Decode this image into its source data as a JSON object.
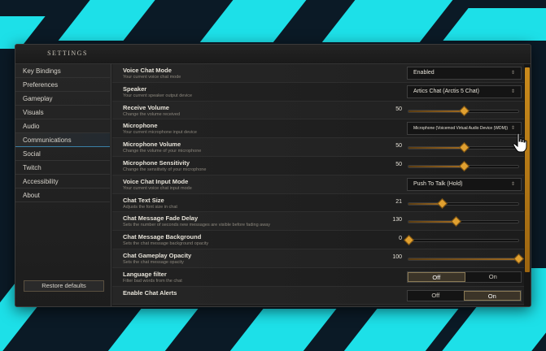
{
  "window": {
    "title": "SETTINGS"
  },
  "sidebar": {
    "items": [
      {
        "label": "Key Bindings"
      },
      {
        "label": "Preferences"
      },
      {
        "label": "Gameplay"
      },
      {
        "label": "Visuals"
      },
      {
        "label": "Audio"
      },
      {
        "label": "Communications",
        "active": true
      },
      {
        "label": "Social"
      },
      {
        "label": "Twitch"
      },
      {
        "label": "Accessibility"
      },
      {
        "label": "About"
      }
    ],
    "restore_label": "Restore defaults"
  },
  "settings": [
    {
      "title": "Voice Chat Mode",
      "desc": "Your current voice chat mode",
      "control": "dropdown",
      "value": "Enabled"
    },
    {
      "title": "Speaker",
      "desc": "Your current speaker output device",
      "control": "dropdown",
      "value": "Artics Chat (Arctis 5 Chat)"
    },
    {
      "title": "Receive Volume",
      "desc": "Change the volume received",
      "control": "slider",
      "value": "50",
      "level": 0.5
    },
    {
      "title": "Microphone",
      "desc": "Your current microphone input device",
      "control": "dropdown",
      "value": "Microphone (Voicemod Virtual Audio Device (WDM))",
      "small": true
    },
    {
      "title": "Microphone Volume",
      "desc": "Change the volume of your microphone",
      "control": "slider",
      "value": "50",
      "level": 0.5
    },
    {
      "title": "Microphone Sensitivity",
      "desc": "Change the sensitivity of your microphone",
      "control": "slider",
      "value": "50",
      "level": 0.5
    },
    {
      "title": "Voice Chat Input Mode",
      "desc": "Your current voice chat input mode",
      "control": "dropdown",
      "value": "Push To Talk (Hold)"
    },
    {
      "title": "Chat Text Size",
      "desc": "Adjusts the font size in chat",
      "control": "slider",
      "value": "21",
      "level": 0.3
    },
    {
      "title": "Chat Message Fade Delay",
      "desc": "Sets the number of seconds new messages are visible before fading away",
      "control": "slider",
      "value": "130",
      "level": 0.43
    },
    {
      "title": "Chat Message Background",
      "desc": "Sets the chat message background opacity",
      "control": "slider",
      "value": "0",
      "level": 0.0
    },
    {
      "title": "Chat Gameplay Opacity",
      "desc": "Sets the chat message opacity",
      "control": "slider",
      "value": "100",
      "level": 1.0
    },
    {
      "title": "Language filter",
      "desc": "Filter bad words from the chat",
      "control": "toggle",
      "options": [
        "Off",
        "On"
      ],
      "selected": 0
    },
    {
      "title": "Enable Chat Alerts",
      "desc": "",
      "control": "toggle",
      "options": [
        "Off",
        "On"
      ],
      "selected": 1
    }
  ],
  "colors": {
    "accent": "#e0a030",
    "cyan_bg": "#1de0e8",
    "active_underline": "#3a7fa6"
  }
}
